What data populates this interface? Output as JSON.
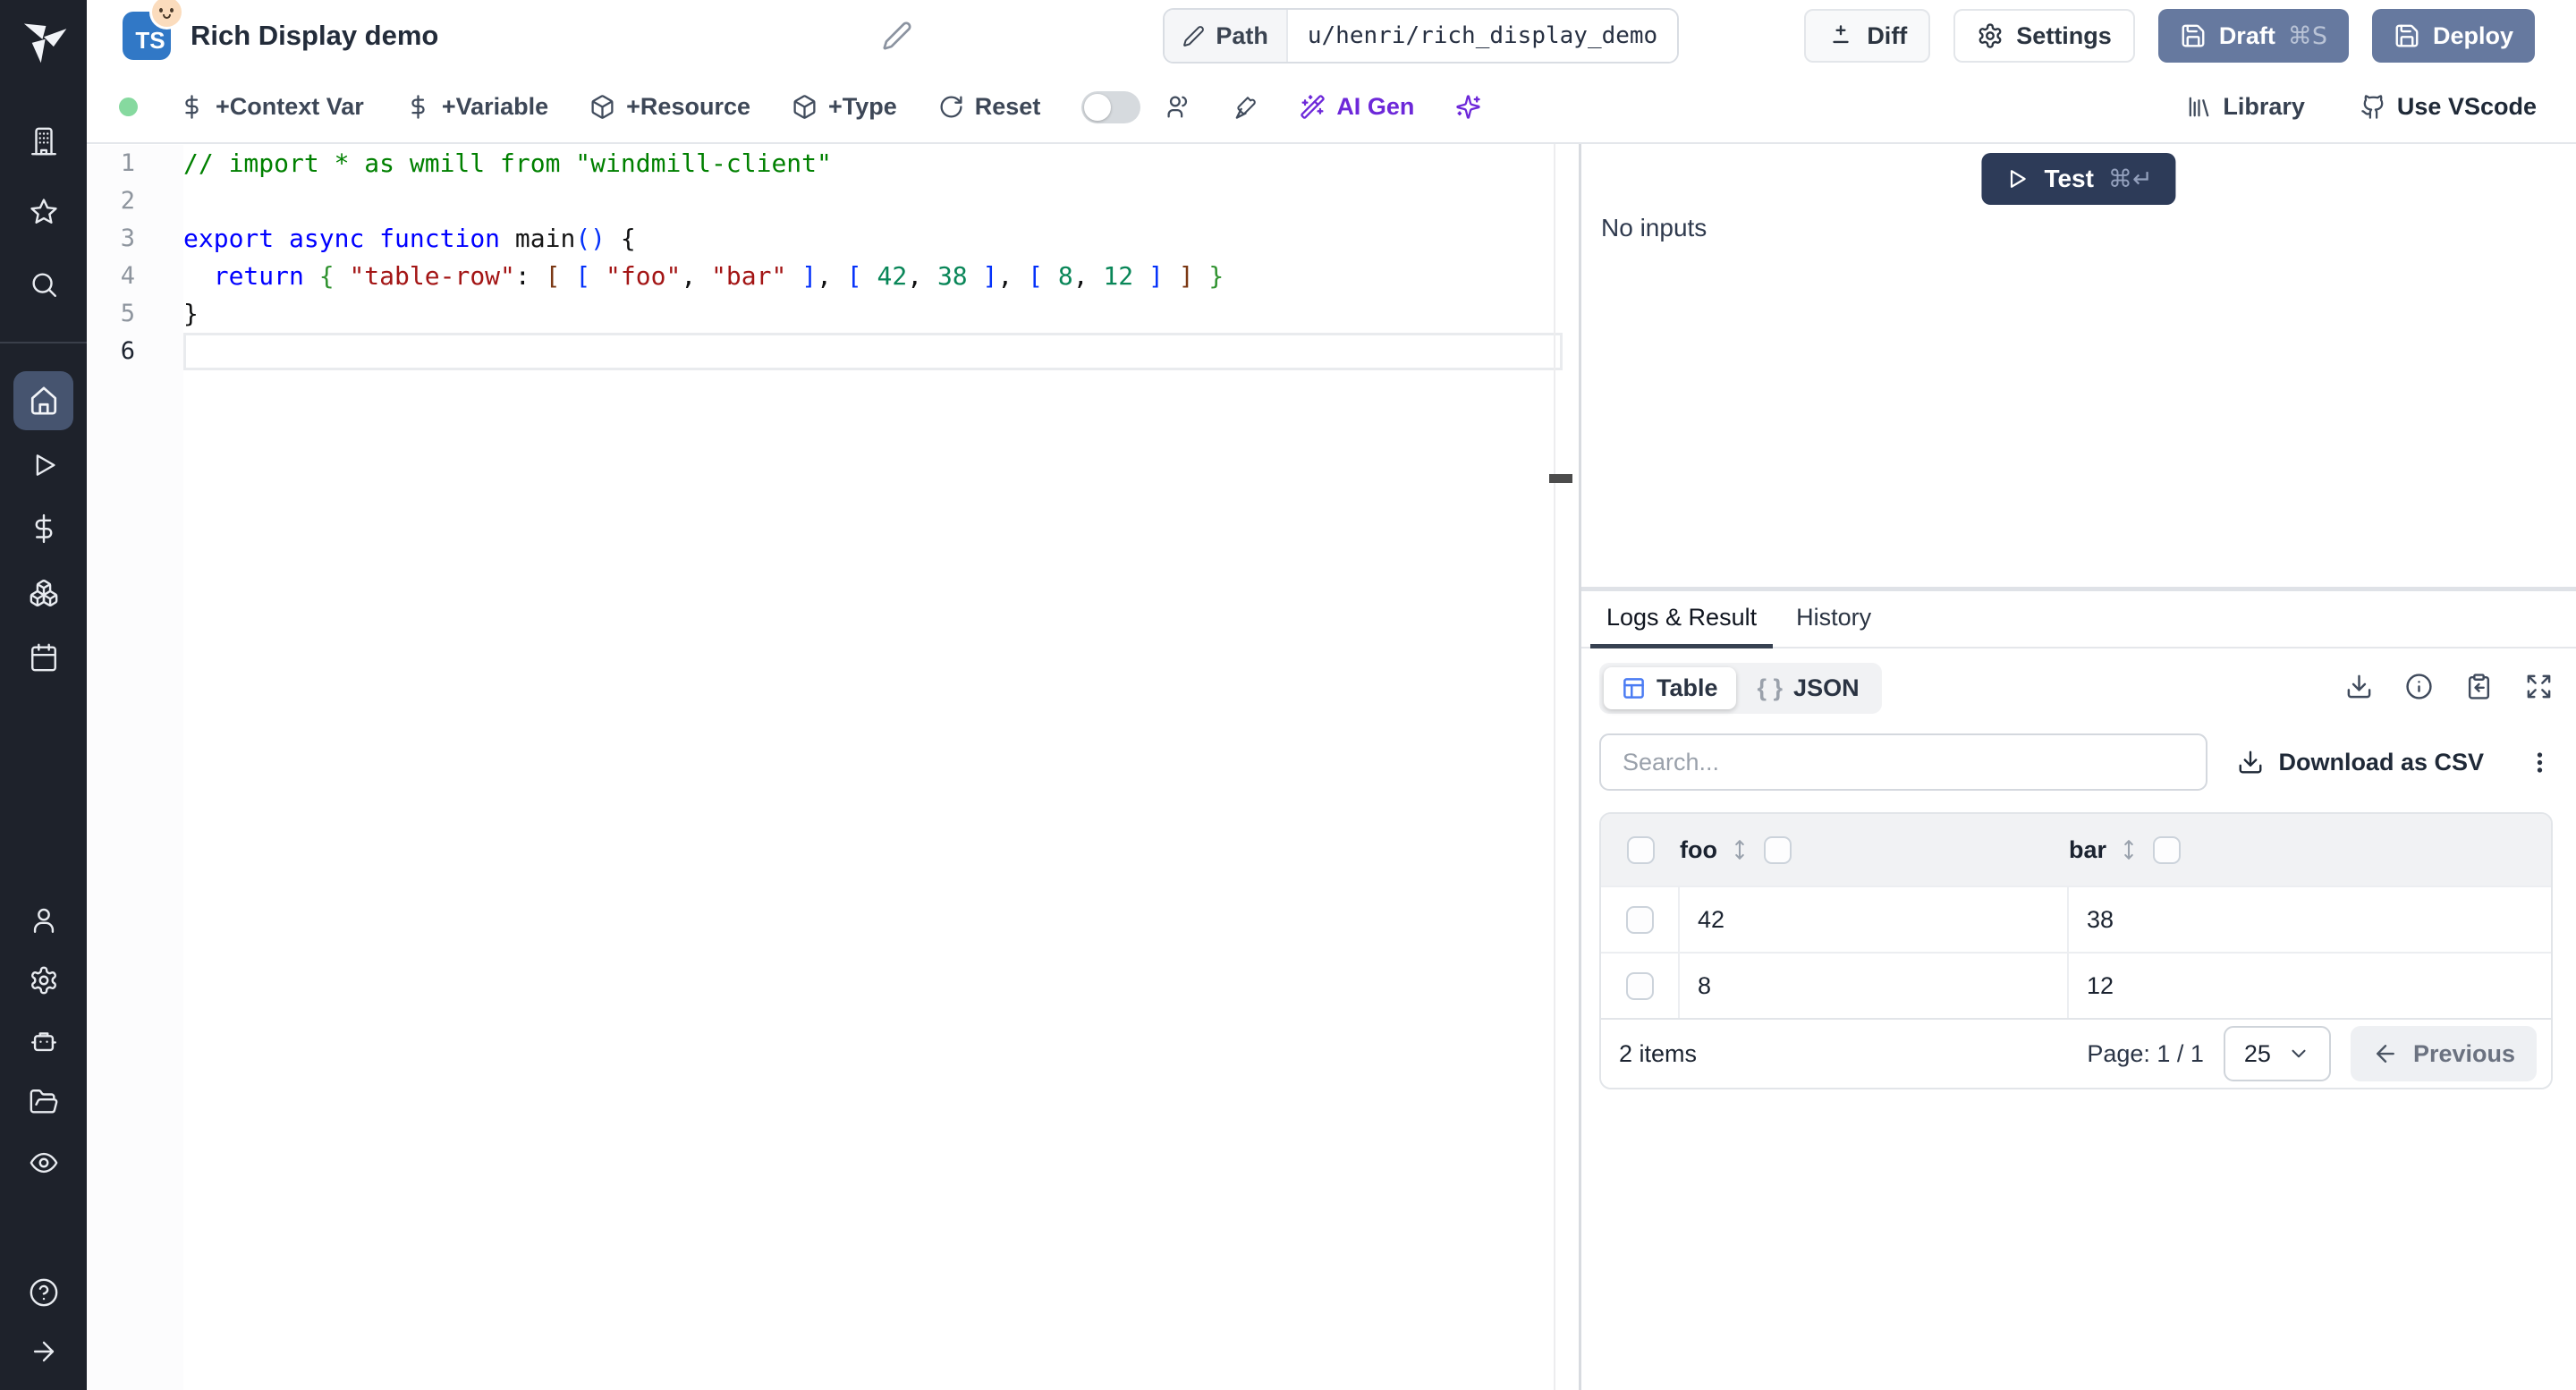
{
  "header": {
    "language_badge": "TS",
    "title": "Rich Display demo",
    "path_label": "Path",
    "path_value": "u/henri/rich_display_demo",
    "diff_label": "Diff",
    "settings_label": "Settings",
    "draft_label": "Draft",
    "draft_shortcut": "⌘S",
    "deploy_label": "Deploy"
  },
  "toolbar": {
    "context_var_label": "+Context Var",
    "variable_label": "+Variable",
    "resource_label": "+Resource",
    "type_label": "+Type",
    "reset_label": "Reset",
    "ai_gen_label": "AI Gen",
    "library_label": "Library",
    "vscode_label": "Use VScode"
  },
  "editor": {
    "lines": [
      {
        "num": "1",
        "tokens": [
          [
            "// import * as wmill from \"windmill-client\"",
            "comment"
          ]
        ]
      },
      {
        "num": "2",
        "tokens": []
      },
      {
        "num": "3",
        "tokens": [
          [
            "export",
            "kw"
          ],
          [
            " ",
            "pl"
          ],
          [
            "async",
            "kw"
          ],
          [
            " ",
            "pl"
          ],
          [
            "function",
            "kw"
          ],
          [
            " ",
            "pl"
          ],
          [
            "main",
            "fn"
          ],
          [
            "()",
            "brB"
          ],
          [
            " ",
            "pl"
          ],
          [
            "{",
            "pl"
          ]
        ]
      },
      {
        "num": "4",
        "tokens": [
          [
            "  ",
            "pl"
          ],
          [
            "return",
            "kw"
          ],
          [
            " ",
            "pl"
          ],
          [
            "{",
            "brG"
          ],
          [
            " ",
            "pl"
          ],
          [
            "\"table-row\"",
            "str"
          ],
          [
            ":",
            "pl"
          ],
          [
            " ",
            "pl"
          ],
          [
            "[",
            "brO"
          ],
          [
            " ",
            "pl"
          ],
          [
            "[",
            "brB"
          ],
          [
            " ",
            "pl"
          ],
          [
            "\"foo\"",
            "str"
          ],
          [
            ",",
            "pl"
          ],
          [
            " ",
            "pl"
          ],
          [
            "\"bar\"",
            "str"
          ],
          [
            " ",
            "pl"
          ],
          [
            "]",
            "brB"
          ],
          [
            ",",
            "pl"
          ],
          [
            " ",
            "pl"
          ],
          [
            "[",
            "brB"
          ],
          [
            " ",
            "pl"
          ],
          [
            "42",
            "num"
          ],
          [
            ",",
            "pl"
          ],
          [
            " ",
            "pl"
          ],
          [
            "38",
            "num"
          ],
          [
            " ",
            "pl"
          ],
          [
            "]",
            "brB"
          ],
          [
            ",",
            "pl"
          ],
          [
            " ",
            "pl"
          ],
          [
            "[",
            "brB"
          ],
          [
            " ",
            "pl"
          ],
          [
            "8",
            "num"
          ],
          [
            ",",
            "pl"
          ],
          [
            " ",
            "pl"
          ],
          [
            "12",
            "num"
          ],
          [
            " ",
            "pl"
          ],
          [
            "]",
            "brB"
          ],
          [
            " ",
            "pl"
          ],
          [
            "]",
            "brO"
          ],
          [
            " ",
            "pl"
          ],
          [
            "}",
            "brG"
          ]
        ]
      },
      {
        "num": "5",
        "tokens": [
          [
            "}",
            "pl"
          ]
        ]
      },
      {
        "num": "6",
        "tokens": [],
        "active": true
      }
    ]
  },
  "runner": {
    "test_label": "Test",
    "test_shortcut": "⌘↵",
    "no_inputs": "No inputs"
  },
  "result_panel": {
    "tab_logs": "Logs & Result",
    "tab_history": "History",
    "view_table": "Table",
    "view_json": "JSON",
    "json_glyph": "{ }",
    "search_placeholder": "Search...",
    "download_csv_label": "Download as CSV"
  },
  "result_table": {
    "columns": [
      "foo",
      "bar"
    ],
    "rows": [
      [
        "42",
        "38"
      ],
      [
        "8",
        "12"
      ]
    ],
    "items_count": "2 items",
    "page_label": "Page: 1 / 1",
    "page_size": "25",
    "previous_label": "Previous"
  },
  "colors": {
    "accent_slate": "#66799f",
    "test_navy": "#2d3b58",
    "ai_purple": "#6d28d9",
    "status_green": "#86d99f",
    "table_icon_blue": "#4b7cf3",
    "sidebar_bg": "#1e222b"
  }
}
